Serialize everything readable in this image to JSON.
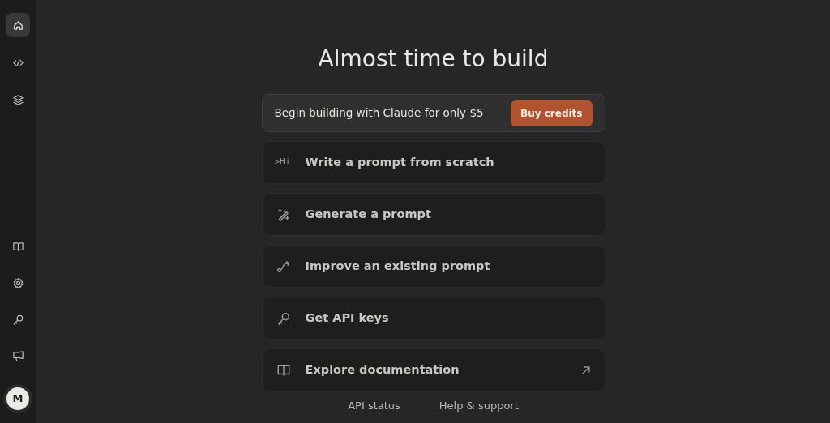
{
  "sidebar": {
    "top_items": [
      {
        "kind": "home",
        "selected": true
      },
      {
        "kind": "code",
        "selected": false
      },
      {
        "kind": "layers",
        "selected": false
      }
    ],
    "bottom_items": [
      {
        "kind": "book",
        "selected": false
      },
      {
        "kind": "settings",
        "selected": false
      },
      {
        "kind": "key",
        "selected": false
      },
      {
        "kind": "megaphone",
        "selected": false
      }
    ],
    "avatar": "M"
  },
  "title": "Almost time to build",
  "banner": {
    "text": "Begin building with Claude for only $5",
    "button": "Buy credits"
  },
  "actions": [
    {
      "kind": "text",
      "icon_text": ">Hi",
      "label": "Write a prompt from scratch",
      "external": false
    },
    {
      "kind": "wand",
      "label": "Generate a prompt",
      "external": false
    },
    {
      "kind": "path",
      "label": "Improve an existing prompt",
      "external": false
    },
    {
      "kind": "key",
      "label": "Get API keys",
      "external": false
    },
    {
      "kind": "book",
      "label": "Explore documentation",
      "external": true
    }
  ],
  "footer_links": [
    "API status",
    "Help & support"
  ]
}
